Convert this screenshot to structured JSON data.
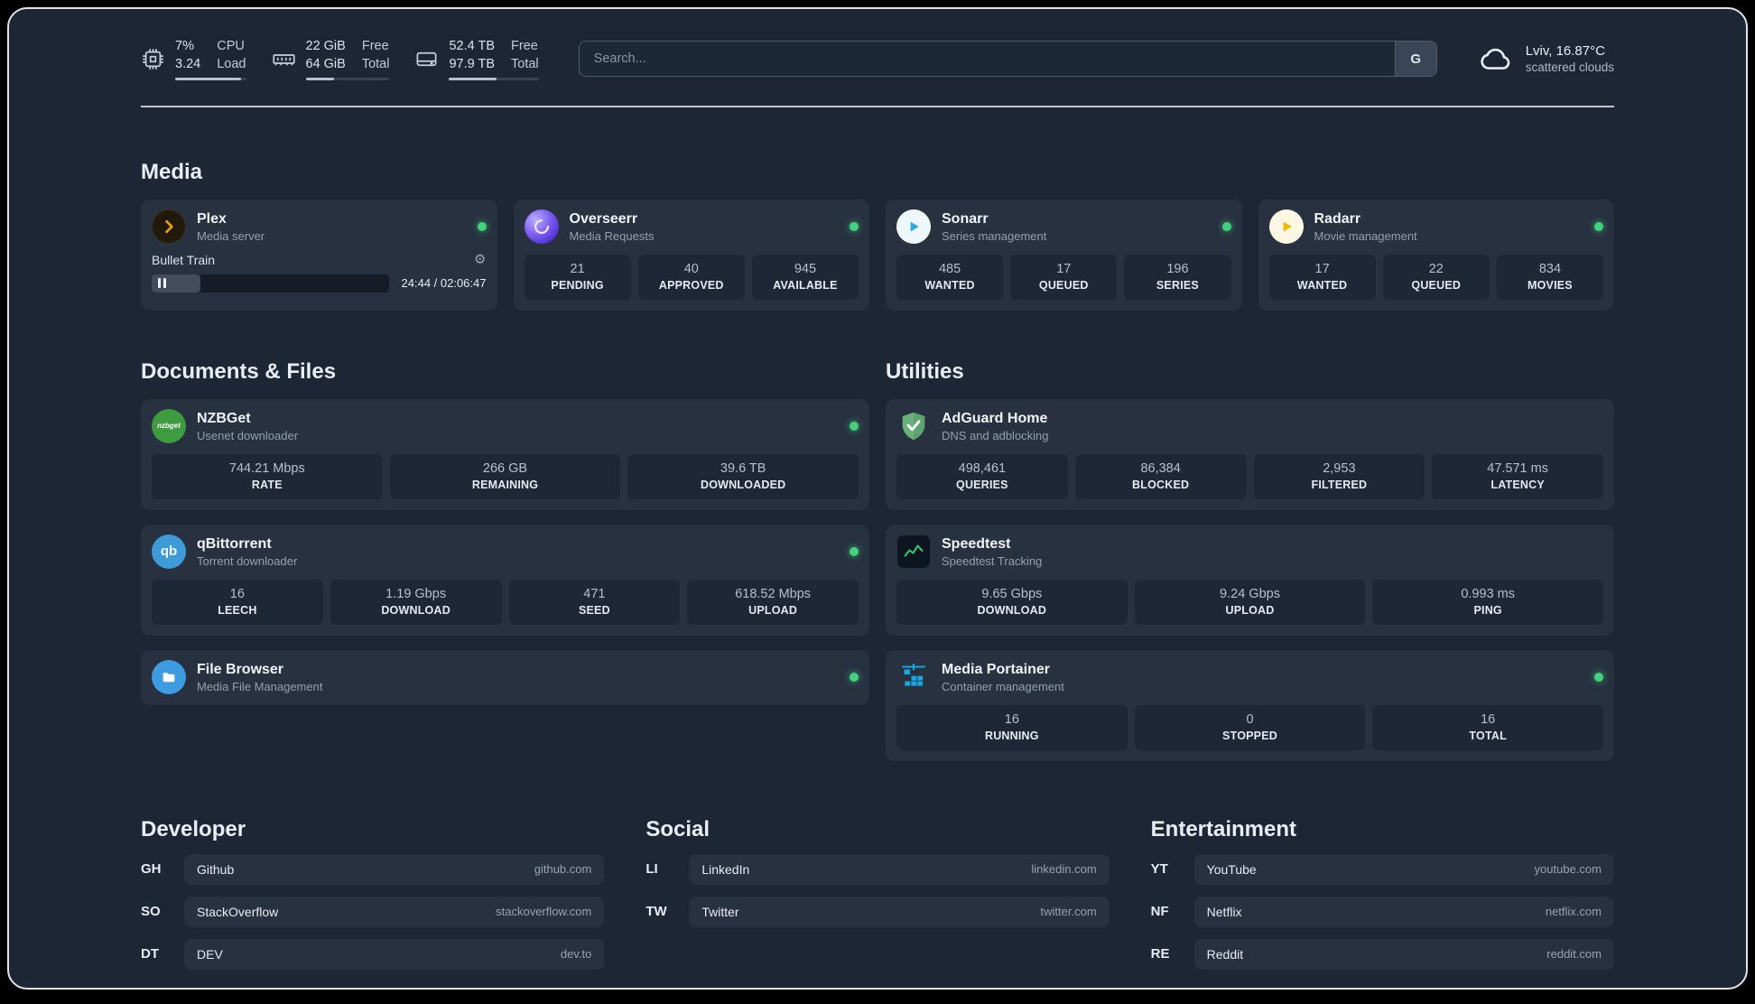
{
  "colors": {
    "status_online": "#43d17d",
    "plex": "#e5a00d",
    "overseerr": "#6d4df0",
    "sonarr": "#2da8dc",
    "radarr": "#f2b705",
    "nzbget": "#3e9b3f",
    "qbittorrent": "#3f9bd8",
    "filebrowser": "#3d9be2",
    "adguard": "#67b279",
    "speedtest_line": "#2fd06c",
    "portainer": "#1aa7e0"
  },
  "header": {
    "cpu": {
      "value1": "7%",
      "label1": "CPU",
      "value2": "3.24",
      "label2": "Load",
      "bar_percent": 93
    },
    "memory": {
      "value1": "22 GiB",
      "label1": "Free",
      "value2": "64 GiB",
      "label2": "Total",
      "bar_percent": 34
    },
    "disk": {
      "value1": "52.4 TB",
      "label1": "Free",
      "value2": "97.9 TB",
      "label2": "Total",
      "bar_percent": 53
    },
    "search": {
      "placeholder": "Search...",
      "button": "G"
    },
    "weather": {
      "location": "Lviv, 16.87°C",
      "condition": "scattered clouds"
    }
  },
  "sections": {
    "media": {
      "title": "Media",
      "services": [
        {
          "name": "Plex",
          "subtitle": "Media server",
          "status": "online",
          "player": {
            "title": "Bullet Train",
            "time": "24:44 / 02:06:47",
            "progress_percent": 19
          }
        },
        {
          "name": "Overseerr",
          "subtitle": "Media Requests",
          "status": "online",
          "stats": [
            {
              "value": "21",
              "label": "PENDING"
            },
            {
              "value": "40",
              "label": "APPROVED"
            },
            {
              "value": "945",
              "label": "AVAILABLE"
            }
          ]
        },
        {
          "name": "Sonarr",
          "subtitle": "Series management",
          "status": "online",
          "stats": [
            {
              "value": "485",
              "label": "WANTED"
            },
            {
              "value": "17",
              "label": "QUEUED"
            },
            {
              "value": "196",
              "label": "SERIES"
            }
          ]
        },
        {
          "name": "Radarr",
          "subtitle": "Movie management",
          "status": "online",
          "stats": [
            {
              "value": "17",
              "label": "WANTED"
            },
            {
              "value": "22",
              "label": "QUEUED"
            },
            {
              "value": "834",
              "label": "MOVIES"
            }
          ]
        }
      ]
    },
    "documents": {
      "title": "Documents & Files",
      "services": [
        {
          "name": "NZBGet",
          "subtitle": "Usenet downloader",
          "status": "online",
          "stats": [
            {
              "value": "744.21 Mbps",
              "label": "RATE"
            },
            {
              "value": "266 GB",
              "label": "REMAINING"
            },
            {
              "value": "39.6 TB",
              "label": "DOWNLOADED"
            }
          ]
        },
        {
          "name": "qBittorrent",
          "subtitle": "Torrent downloader",
          "status": "online",
          "stats": [
            {
              "value": "16",
              "label": "LEECH"
            },
            {
              "value": "1.19 Gbps",
              "label": "DOWNLOAD"
            },
            {
              "value": "471",
              "label": "SEED"
            },
            {
              "value": "618.52 Mbps",
              "label": "UPLOAD"
            }
          ]
        },
        {
          "name": "File Browser",
          "subtitle": "Media File Management",
          "status": "online"
        }
      ]
    },
    "utilities": {
      "title": "Utilities",
      "services": [
        {
          "name": "AdGuard Home",
          "subtitle": "DNS and adblocking",
          "stats": [
            {
              "value": "498,461",
              "label": "QUERIES"
            },
            {
              "value": "86,384",
              "label": "BLOCKED"
            },
            {
              "value": "2,953",
              "label": "FILTERED"
            },
            {
              "value": "47.571 ms",
              "label": "LATENCY"
            }
          ]
        },
        {
          "name": "Speedtest",
          "subtitle": "Speedtest Tracking",
          "stats": [
            {
              "value": "9.65 Gbps",
              "label": "DOWNLOAD"
            },
            {
              "value": "9.24 Gbps",
              "label": "UPLOAD"
            },
            {
              "value": "0.993 ms",
              "label": "PING"
            }
          ]
        },
        {
          "name": "Media Portainer",
          "subtitle": "Container management",
          "status": "online",
          "stats": [
            {
              "value": "16",
              "label": "RUNNING"
            },
            {
              "value": "0",
              "label": "STOPPED"
            },
            {
              "value": "16",
              "label": "TOTAL"
            }
          ]
        }
      ]
    }
  },
  "bookmarks": {
    "developer": {
      "title": "Developer",
      "items": [
        {
          "abbr": "GH",
          "name": "Github",
          "domain": "github.com"
        },
        {
          "abbr": "SO",
          "name": "StackOverflow",
          "domain": "stackoverflow.com"
        },
        {
          "abbr": "DT",
          "name": "DEV",
          "domain": "dev.to"
        }
      ]
    },
    "social": {
      "title": "Social",
      "items": [
        {
          "abbr": "LI",
          "name": "LinkedIn",
          "domain": "linkedin.com"
        },
        {
          "abbr": "TW",
          "name": "Twitter",
          "domain": "twitter.com"
        }
      ]
    },
    "entertainment": {
      "title": "Entertainment",
      "items": [
        {
          "abbr": "YT",
          "name": "YouTube",
          "domain": "youtube.com"
        },
        {
          "abbr": "NF",
          "name": "Netflix",
          "domain": "netflix.com"
        },
        {
          "abbr": "RE",
          "name": "Reddit",
          "domain": "reddit.com"
        }
      ]
    }
  }
}
